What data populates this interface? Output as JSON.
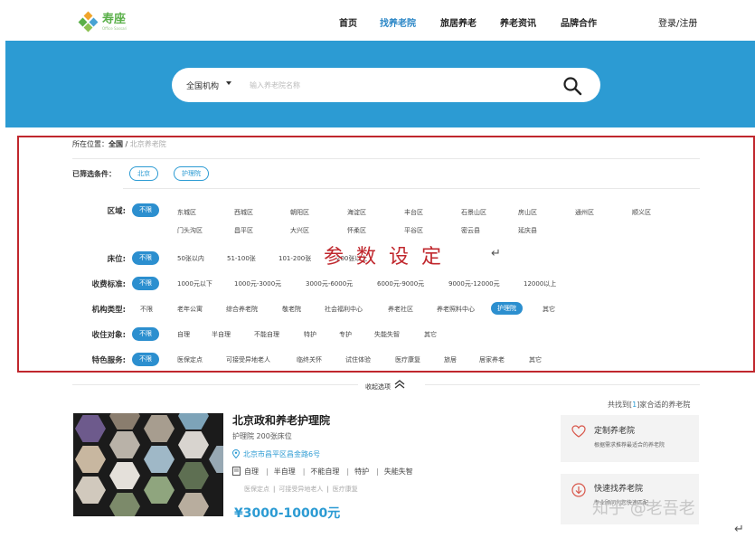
{
  "brand": {
    "name": "寿座",
    "subtitle": "Office Sassari"
  },
  "nav": {
    "items": [
      {
        "label": "首页",
        "active": false
      },
      {
        "label": "找养老院",
        "active": true
      },
      {
        "label": "旅居养老",
        "active": false
      },
      {
        "label": "养老资讯",
        "active": false
      },
      {
        "label": "品牌合作",
        "active": false
      }
    ],
    "login": "登录/注册"
  },
  "search": {
    "scope": "全国机构",
    "placeholder": "输入养老院名称",
    "button_icon": "search-icon"
  },
  "breadcrumb": {
    "prefix": "所在位置：",
    "home": "全国",
    "sep": " / ",
    "current": "北京养老院"
  },
  "selected": {
    "label": "已筛选条件：",
    "tags": [
      "北京",
      "护理院"
    ]
  },
  "filters": {
    "region": {
      "label": "区域:",
      "unlimited": "不限",
      "options": [
        "东城区",
        "西城区",
        "朝阳区",
        "海淀区",
        "丰台区",
        "石景山区",
        "房山区",
        "通州区",
        "顺义区",
        "门头沟区",
        "昌平区",
        "大兴区",
        "怀柔区",
        "平谷区",
        "密云县",
        "延庆县"
      ]
    },
    "beds": {
      "label": "床位:",
      "unlimited": "不限",
      "options": [
        "50张以内",
        "51-100张",
        "101-200张",
        "200张以上"
      ]
    },
    "fee": {
      "label": "收费标准:",
      "unlimited": "不限",
      "options": [
        "1000元以下",
        "1000元-3000元",
        "3000元-6000元",
        "6000元-9000元",
        "9000元-12000元",
        "12000以上"
      ]
    },
    "type": {
      "label": "机构类型:",
      "unlimited": "不限",
      "options": [
        "老年公寓",
        "综合养老院",
        "敬老院",
        "社会福利中心",
        "养老社区",
        "养老照料中心",
        "护理院",
        "其它"
      ],
      "active": "护理院"
    },
    "target": {
      "label": "收住对象:",
      "unlimited": "不限",
      "options": [
        "自理",
        "半自理",
        "不能自理",
        "特护",
        "专护",
        "失能失智",
        "其它"
      ]
    },
    "service": {
      "label": "特色服务:",
      "unlimited": "不限",
      "options": [
        "医保定点",
        "可接受异地老人",
        "临终关怀",
        "试住体验",
        "医疗康复",
        "旅居",
        "居家养老",
        "其它"
      ]
    }
  },
  "annotation": {
    "text": "参数设定",
    "mark": "↵"
  },
  "collapse": {
    "label": "收起选项"
  },
  "result": {
    "count_prefix": "共找到[",
    "count": "1",
    "count_suffix": "]家合适的养老院"
  },
  "card": {
    "title": "北京政和养老护理院",
    "subtitle": "护理院 200张床位",
    "address": "北京市昌平区昌金路6号",
    "tags": [
      "自理",
      "半自理",
      "不能自理",
      "特护",
      "失能失智"
    ],
    "features": [
      "医保定点",
      "可接受异地老人",
      "医疗康复"
    ],
    "price": "¥3000-10000元"
  },
  "side": {
    "custom": {
      "title": "定制养老院",
      "desc": "根据需求推荐最适合的养老院"
    },
    "quick": {
      "title": "快速找养老院",
      "desc": "专业顾问为您快速匹配"
    }
  },
  "watermark": "知乎 @老吾老",
  "return_mark": "↵",
  "colors": {
    "accent": "#2c9bd3",
    "annotation": "#c0272d",
    "logo": "#5bb04a"
  }
}
